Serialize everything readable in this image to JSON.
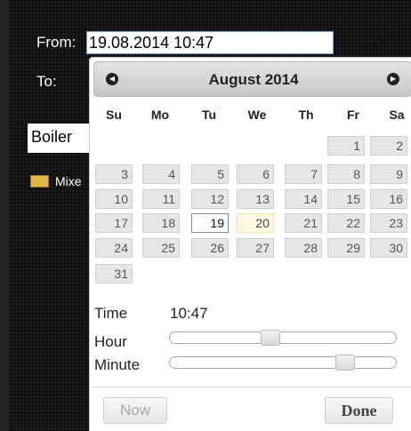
{
  "form": {
    "from_label": "From:",
    "from_value": "19.08.2014 10:47",
    "to_label": "To:",
    "device_value": "Boiler",
    "legend_label": "Mixe",
    "legend_color": "#e0b84a"
  },
  "datepicker": {
    "month_title": "August 2014",
    "prev_icon": "prev-circle-icon",
    "next_icon": "next-circle-icon",
    "weekdays": [
      "Su",
      "Mo",
      "Tu",
      "We",
      "Th",
      "Fr",
      "Sa"
    ],
    "weeks": [
      [
        "",
        "",
        "",
        "",
        "",
        "1",
        "2"
      ],
      [
        "3",
        "4",
        "5",
        "6",
        "7",
        "8",
        "9"
      ],
      [
        "10",
        "11",
        "12",
        "13",
        "14",
        "15",
        "16"
      ],
      [
        "17",
        "18",
        "19",
        "20",
        "21",
        "22",
        "23"
      ],
      [
        "24",
        "25",
        "26",
        "27",
        "28",
        "29",
        "30"
      ],
      [
        "31",
        "",
        "",
        "",
        "",
        "",
        ""
      ]
    ],
    "selected_day": "19",
    "highlighted_day": "20",
    "time_label": "Time",
    "time_value": "10:47",
    "hour_label": "Hour",
    "minute_label": "Minute",
    "hour_value": 10,
    "minute_value": 47,
    "now_label": "Now",
    "done_label": "Done"
  }
}
